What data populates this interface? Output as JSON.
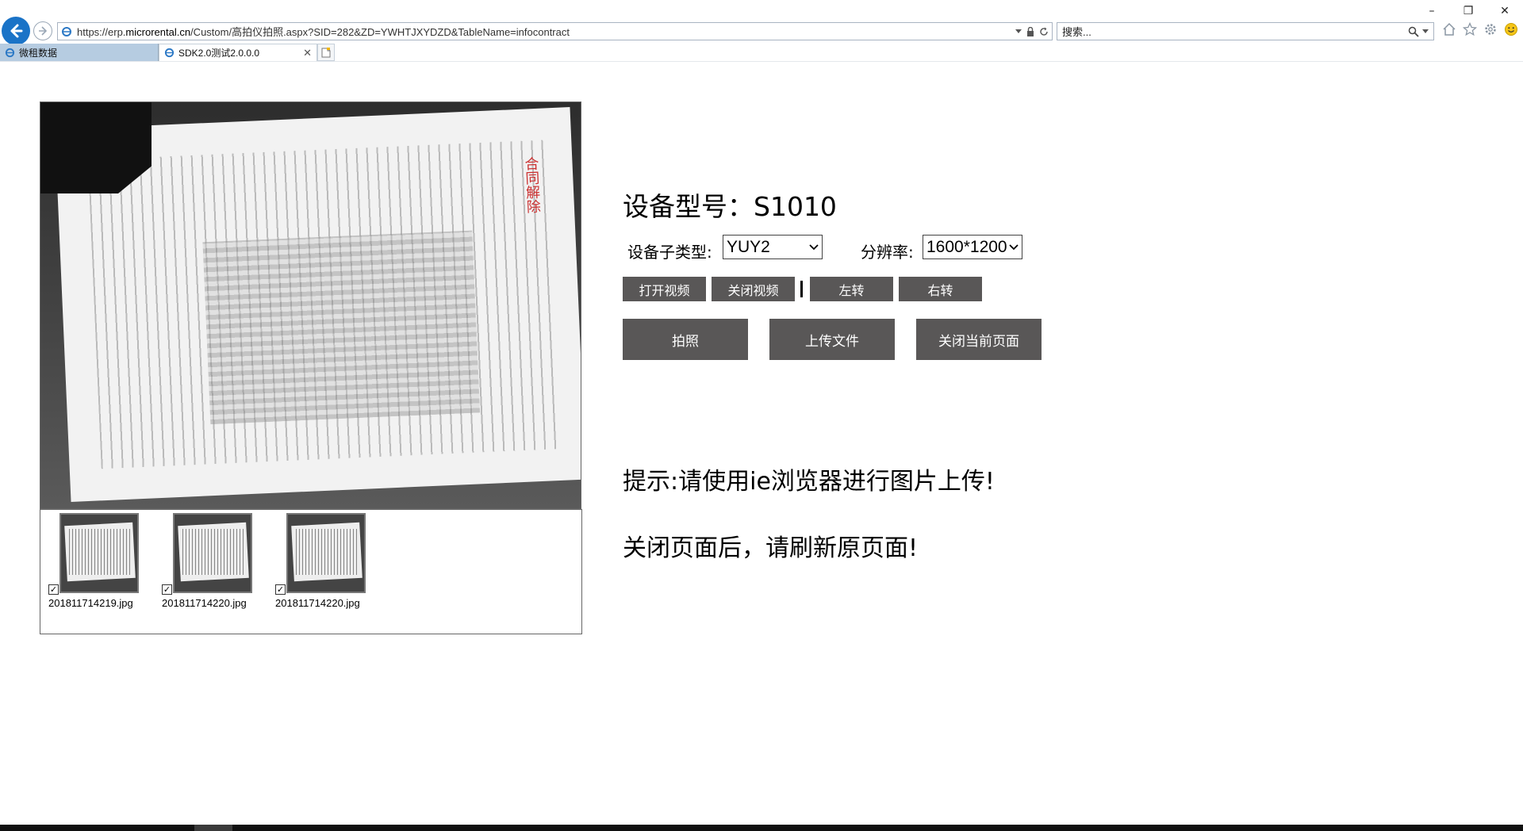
{
  "browser": {
    "url_prefix": "https://erp.",
    "url_domain": "microrental.cn",
    "url_path": "/Custom/高拍仪拍照.aspx?SID=282&ZD=YWHTJXYDZD&TableName=infocontract",
    "search_placeholder": "搜索...",
    "tabs": [
      {
        "label": "微租数据",
        "active": false
      },
      {
        "label": "SDK2.0测试2.0.0.0",
        "active": true
      }
    ],
    "window_controls": {
      "minimize": "–",
      "restore": "❐",
      "close": "✕"
    }
  },
  "preview": {
    "stamp_text": "合同解除"
  },
  "thumbnails": [
    {
      "filename": "201811714219.jpg",
      "checked": true
    },
    {
      "filename": "201811714220.jpg",
      "checked": true
    },
    {
      "filename": "201811714220.jpg",
      "checked": true
    }
  ],
  "device": {
    "model_text": "设备型号：S1010",
    "subtype_label": "设备子类型:",
    "subtype_value": "YUY2",
    "resolution_label": "分辨率:",
    "resolution_value": "1600*1200"
  },
  "buttons": {
    "open_video": "打开视频",
    "close_video": "关闭视频",
    "rotate_left": "左转",
    "rotate_right": "右转",
    "take_photo": "拍照",
    "upload_file": "上传文件",
    "close_page": "关闭当前页面"
  },
  "hints": {
    "browser_hint": "提示:请使用ie浏览器进行图片上传!",
    "refresh_hint": "关闭页面后，请刷新原页面!"
  },
  "colors": {
    "button_bg": "#595757",
    "back_button": "#1a73c7",
    "inactive_tab": "#b6cce1"
  }
}
